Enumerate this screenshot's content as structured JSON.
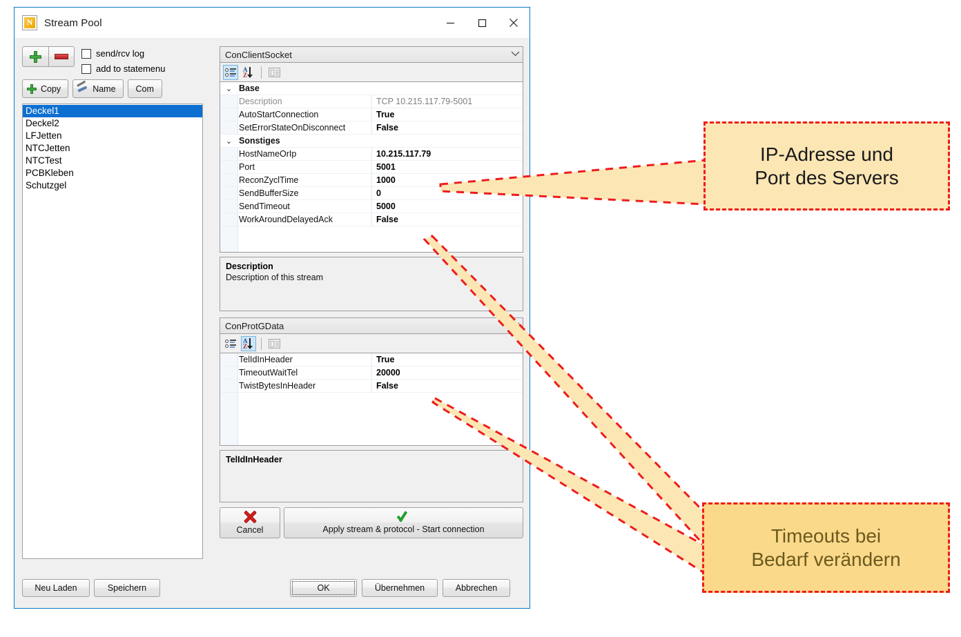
{
  "window": {
    "title": "Stream Pool",
    "icon": "app-icon",
    "controls": {
      "minimize": "—",
      "maximize": "□",
      "close": "✕"
    }
  },
  "toolbar": {
    "add_label": "",
    "remove_label": "",
    "copy_label": "Copy",
    "name_label": "Name",
    "com_label": "Com",
    "check_sendrcv": "send/rcv log",
    "check_statemenu": "add to statemenu"
  },
  "stream_list": {
    "items": [
      {
        "label": "Deckel1",
        "selected": true
      },
      {
        "label": "Deckel2",
        "selected": false
      },
      {
        "label": "LFJetten",
        "selected": false
      },
      {
        "label": "NTCJetten",
        "selected": false
      },
      {
        "label": "NTCTest",
        "selected": false
      },
      {
        "label": "PCBKleben",
        "selected": false
      },
      {
        "label": "Schutzgel",
        "selected": false
      }
    ]
  },
  "stream_grid": {
    "header": "ConClientSocket",
    "caret": "⌄",
    "rows": [
      {
        "kind": "category",
        "expander": "⌄",
        "name": "Base",
        "value": ""
      },
      {
        "kind": "dim",
        "expander": "",
        "name": "Description",
        "value": "TCP 10.215.117.79-5001"
      },
      {
        "kind": "prop",
        "expander": "",
        "name": "AutoStartConnection",
        "value": "True"
      },
      {
        "kind": "prop",
        "expander": "",
        "name": "SetErrorStateOnDisconnect",
        "value": "False"
      },
      {
        "kind": "category",
        "expander": "⌄",
        "name": "Sonstiges",
        "value": ""
      },
      {
        "kind": "prop",
        "expander": "",
        "name": "HostNameOrIp",
        "value": "10.215.117.79"
      },
      {
        "kind": "prop",
        "expander": "",
        "name": "Port",
        "value": "5001"
      },
      {
        "kind": "prop",
        "expander": "",
        "name": "ReconZyclTime",
        "value": "1000"
      },
      {
        "kind": "prop",
        "expander": "",
        "name": "SendBufferSize",
        "value": "0"
      },
      {
        "kind": "prop",
        "expander": "",
        "name": "SendTimeout",
        "value": "5000"
      },
      {
        "kind": "prop",
        "expander": "",
        "name": "WorkAroundDelayedAck",
        "value": "False"
      }
    ],
    "description": {
      "title": "Description",
      "text": "Description of this stream"
    }
  },
  "protocol_grid": {
    "header": "ConProtGData",
    "caret": "⌄",
    "rows": [
      {
        "kind": "prop",
        "expander": "",
        "name": "TelIdInHeader",
        "value": "True"
      },
      {
        "kind": "prop",
        "expander": "",
        "name": "TimeoutWaitTel",
        "value": "20000"
      },
      {
        "kind": "prop",
        "expander": "",
        "name": "TwistBytesInHeader",
        "value": "False"
      }
    ],
    "description": {
      "title": "TelIdInHeader",
      "text": ""
    }
  },
  "actions": {
    "cancel_label": "Cancel",
    "apply_label": "Apply stream & protocol - Start connection"
  },
  "dialog_buttons": {
    "reload": "Neu Laden",
    "save": "Speichern",
    "ok": "OK",
    "apply": "Übernehmen",
    "cancel": "Abbrechen"
  },
  "annotations": {
    "ip_port": "IP-Adresse und\nPort des Servers",
    "ip_port_line1": "IP-Adresse und",
    "ip_port_line2": "Port des Servers",
    "timeouts_line1": "Timeouts bei",
    "timeouts_line2": "Bedarf verändern",
    "callout_fill_1": "#fbe6b4",
    "callout_fill_2": "#fbd98a",
    "callout_border": "#ee1c1c"
  }
}
